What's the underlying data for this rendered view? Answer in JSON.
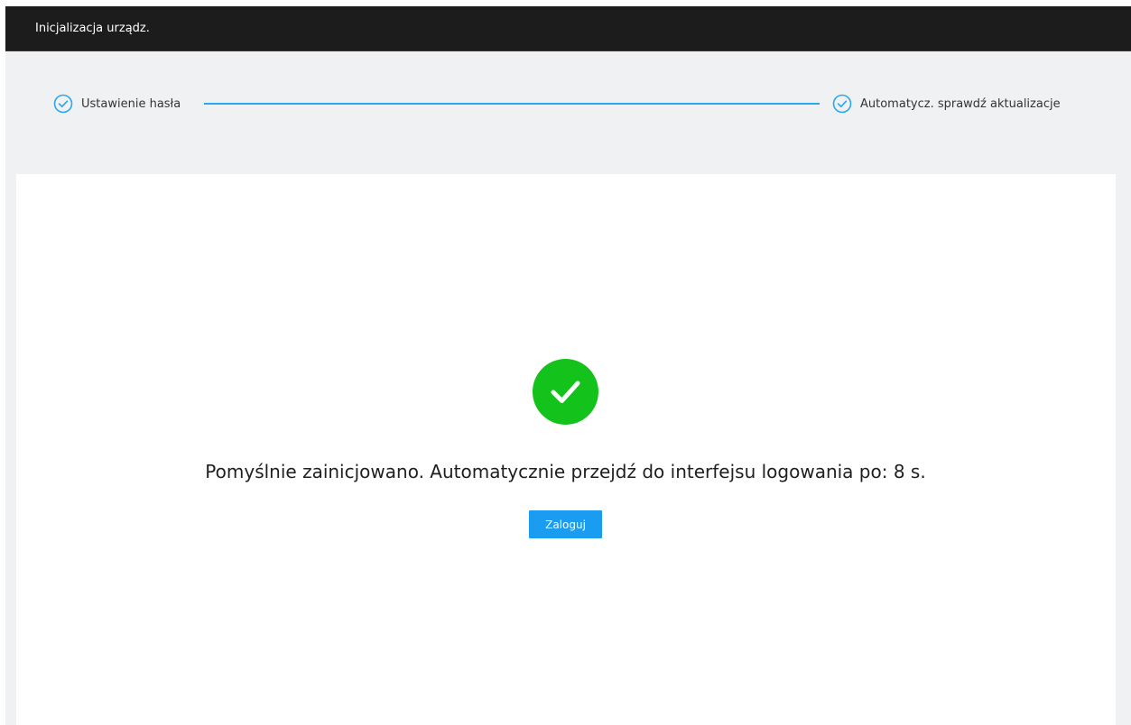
{
  "window": {
    "title": "Inicjalizacja urządz."
  },
  "steps": [
    {
      "label": "Ustawienie hasła",
      "icon": "check-circle-icon",
      "status": "completed"
    },
    {
      "label": "Automatycz. sprawdź aktualizacje",
      "icon": "check-circle-icon",
      "status": "completed"
    }
  ],
  "result": {
    "icon": "success-check-icon",
    "message": "Pomyślnie zainicjowano. Automatycznie przejdź do interfejsu logowania po: 8 s.",
    "button_label": "Zaloguj"
  },
  "colors": {
    "accent": "#2aa6f2",
    "success": "#13c21a",
    "button": "#1a9cf0",
    "topbar": "#1c1c1c",
    "background": "#f0f1f3"
  }
}
